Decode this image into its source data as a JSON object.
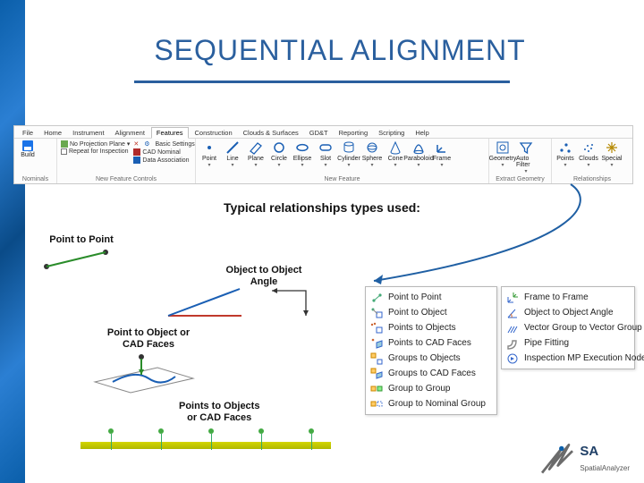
{
  "title": "SEQUENTIAL ALIGNMENT",
  "ribbon": {
    "tabs": [
      "File",
      "Home",
      "Instrument",
      "Alignment",
      "Features",
      "Construction",
      "Clouds & Surfaces",
      "GD&T",
      "Reporting",
      "Scripting",
      "Help"
    ],
    "active_index": 4,
    "build_group": {
      "label": "Build",
      "nominals": "Nominals"
    },
    "nfc": {
      "no_proj": "No Projection Plane",
      "repeat": "Repeat for Inspection",
      "basic": "Basic Settings",
      "cad": "CAD Nominal",
      "data": "Data Association",
      "group_label": "New Feature Controls"
    },
    "nf": {
      "items": [
        "Point",
        "Line",
        "Plane",
        "Circle",
        "Ellipse",
        "Slot",
        "Cylinder",
        "Sphere",
        "Cone",
        "Paraboloid",
        "Frame"
      ],
      "group_label": "New Feature"
    },
    "eg": {
      "items": [
        "Geometry",
        "Auto Filter"
      ],
      "group_label": "Extract Geometry"
    },
    "rel": {
      "items": [
        "Points",
        "Clouds",
        "Special"
      ],
      "group_label": "Relationships"
    }
  },
  "caption": "Typical relationships types used:",
  "anno": {
    "pp": "Point to Point",
    "oo": "Object to Object\nAngle",
    "po": "Point to Object or\nCAD Faces",
    "ps": "Points to Objects\nor CAD Faces"
  },
  "menuA": [
    "Point to Point",
    "Point to Object",
    "Points to Objects",
    "Points to CAD Faces",
    "Groups to Objects",
    "Groups to CAD Faces",
    "Group to Group",
    "Group to Nominal Group"
  ],
  "menuB": [
    "Frame to Frame",
    "Object to Object Angle",
    "Vector Group to Vector Group",
    "Pipe Fitting",
    "Inspection MP Execution Node"
  ],
  "brand": {
    "name": "SpatialAnalyzer",
    "abbr": "SA"
  }
}
